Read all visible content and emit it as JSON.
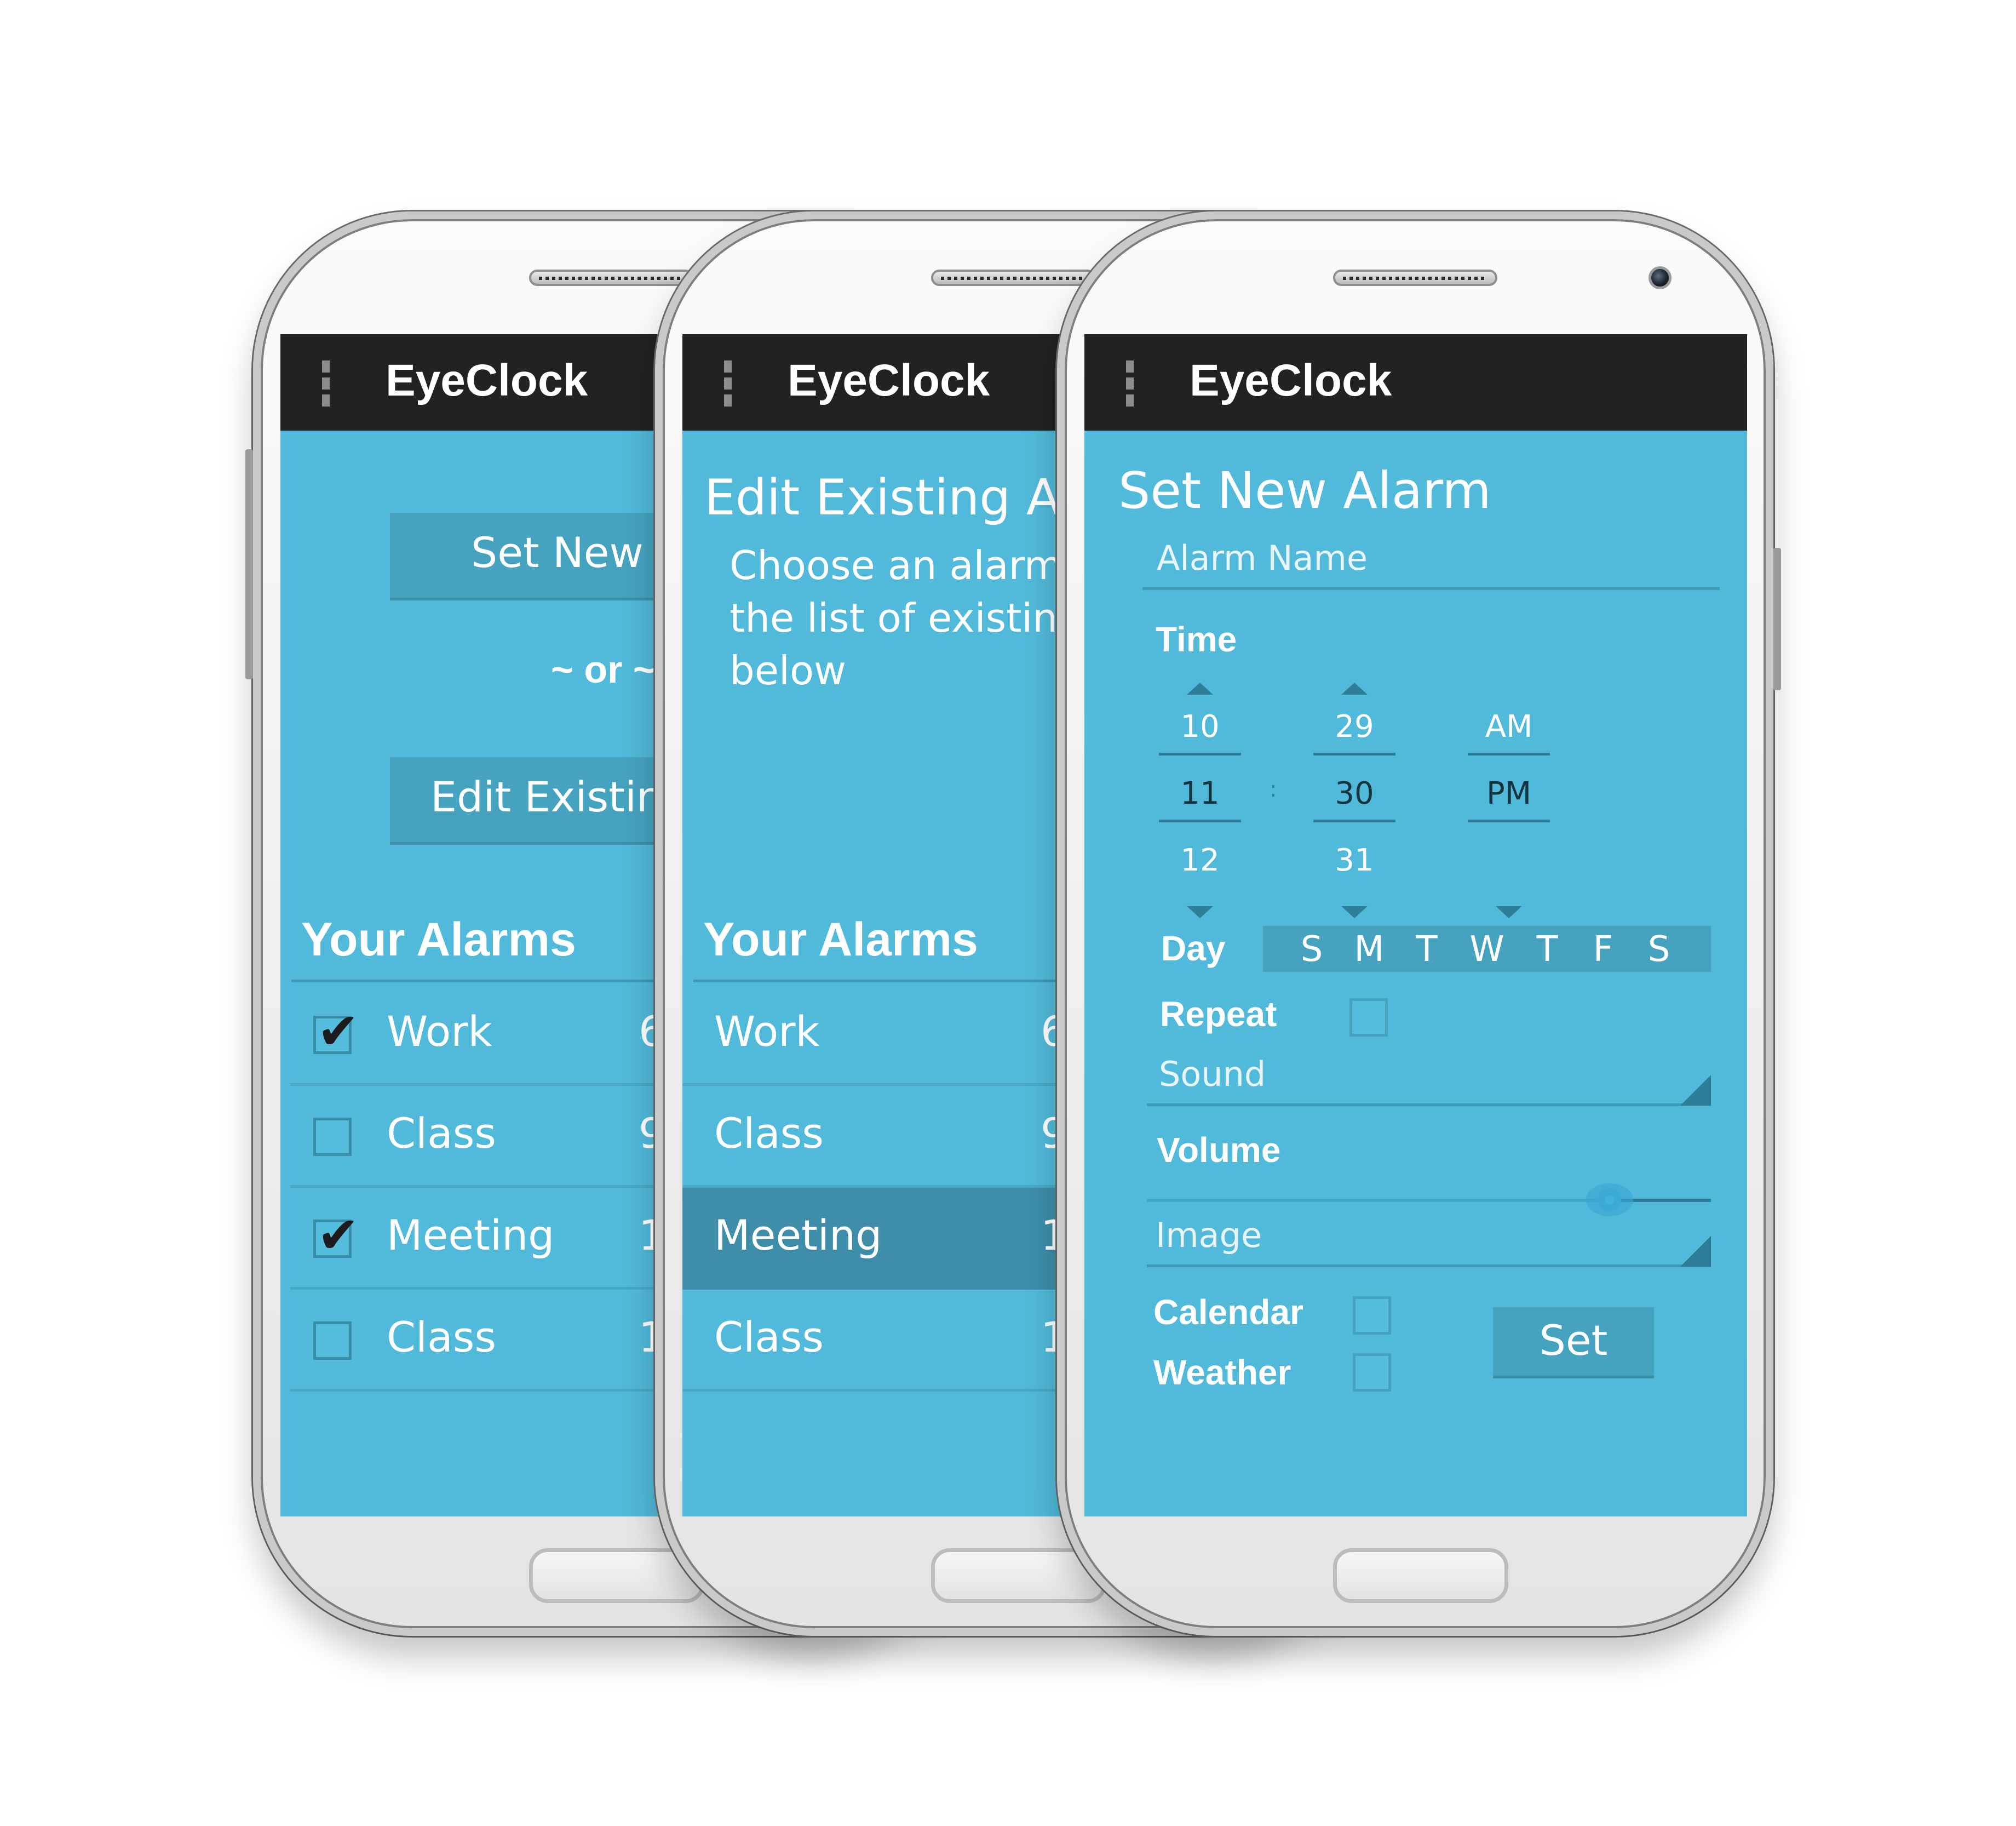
{
  "app": {
    "title": "EyeClock"
  },
  "screen1": {
    "set_new_button": "Set New A",
    "or_text": "~ or ~",
    "edit_existing_button": "Edit Existin",
    "section_title": "Your Alarms",
    "alarms": [
      {
        "name": "Work",
        "time": "6",
        "checked": true
      },
      {
        "name": "Class",
        "time": "9",
        "checked": false
      },
      {
        "name": "Meeting",
        "time": "1",
        "checked": true
      },
      {
        "name": "Class",
        "time": "1",
        "checked": false
      }
    ]
  },
  "screen2": {
    "title": "Edit Existing A",
    "description_line1": "Choose an alarm f",
    "description_line2": "the list of existing",
    "description_line3": "below",
    "section_title": "Your Alarms",
    "alarms": [
      {
        "name": "Work",
        "time": "6"
      },
      {
        "name": "Class",
        "time": "9"
      },
      {
        "name": "Meeting",
        "time": "1",
        "selected": true
      },
      {
        "name": "Class",
        "time": "1"
      }
    ]
  },
  "screen3": {
    "title": "Set New Alarm",
    "alarm_name_placeholder": "Alarm Name",
    "time_label": "Time",
    "hours": {
      "prev": "10",
      "current": "11",
      "next": "12"
    },
    "separator": ":",
    "minutes": {
      "prev": "29",
      "current": "30",
      "next": "31"
    },
    "ampm": {
      "prev": "AM",
      "current": "PM"
    },
    "day_label": "Day",
    "days": [
      "S",
      "M",
      "T",
      "W",
      "T",
      "F",
      "S"
    ],
    "repeat_label": "Repeat",
    "repeat_checked": false,
    "sound_placeholder": "Sound",
    "volume_label": "Volume",
    "volume_level": 0.82,
    "image_placeholder": "Image",
    "calendar_label": "Calendar",
    "calendar_checked": false,
    "weather_label": "Weather",
    "weather_checked": false,
    "set_button": "Set"
  },
  "colors": {
    "screen_bg": "#51b9d9",
    "action_bar": "#222222",
    "button_bg": "#45a3c0",
    "selected_row": "#3e8ea9",
    "accent_dark": "#2f7e99"
  }
}
